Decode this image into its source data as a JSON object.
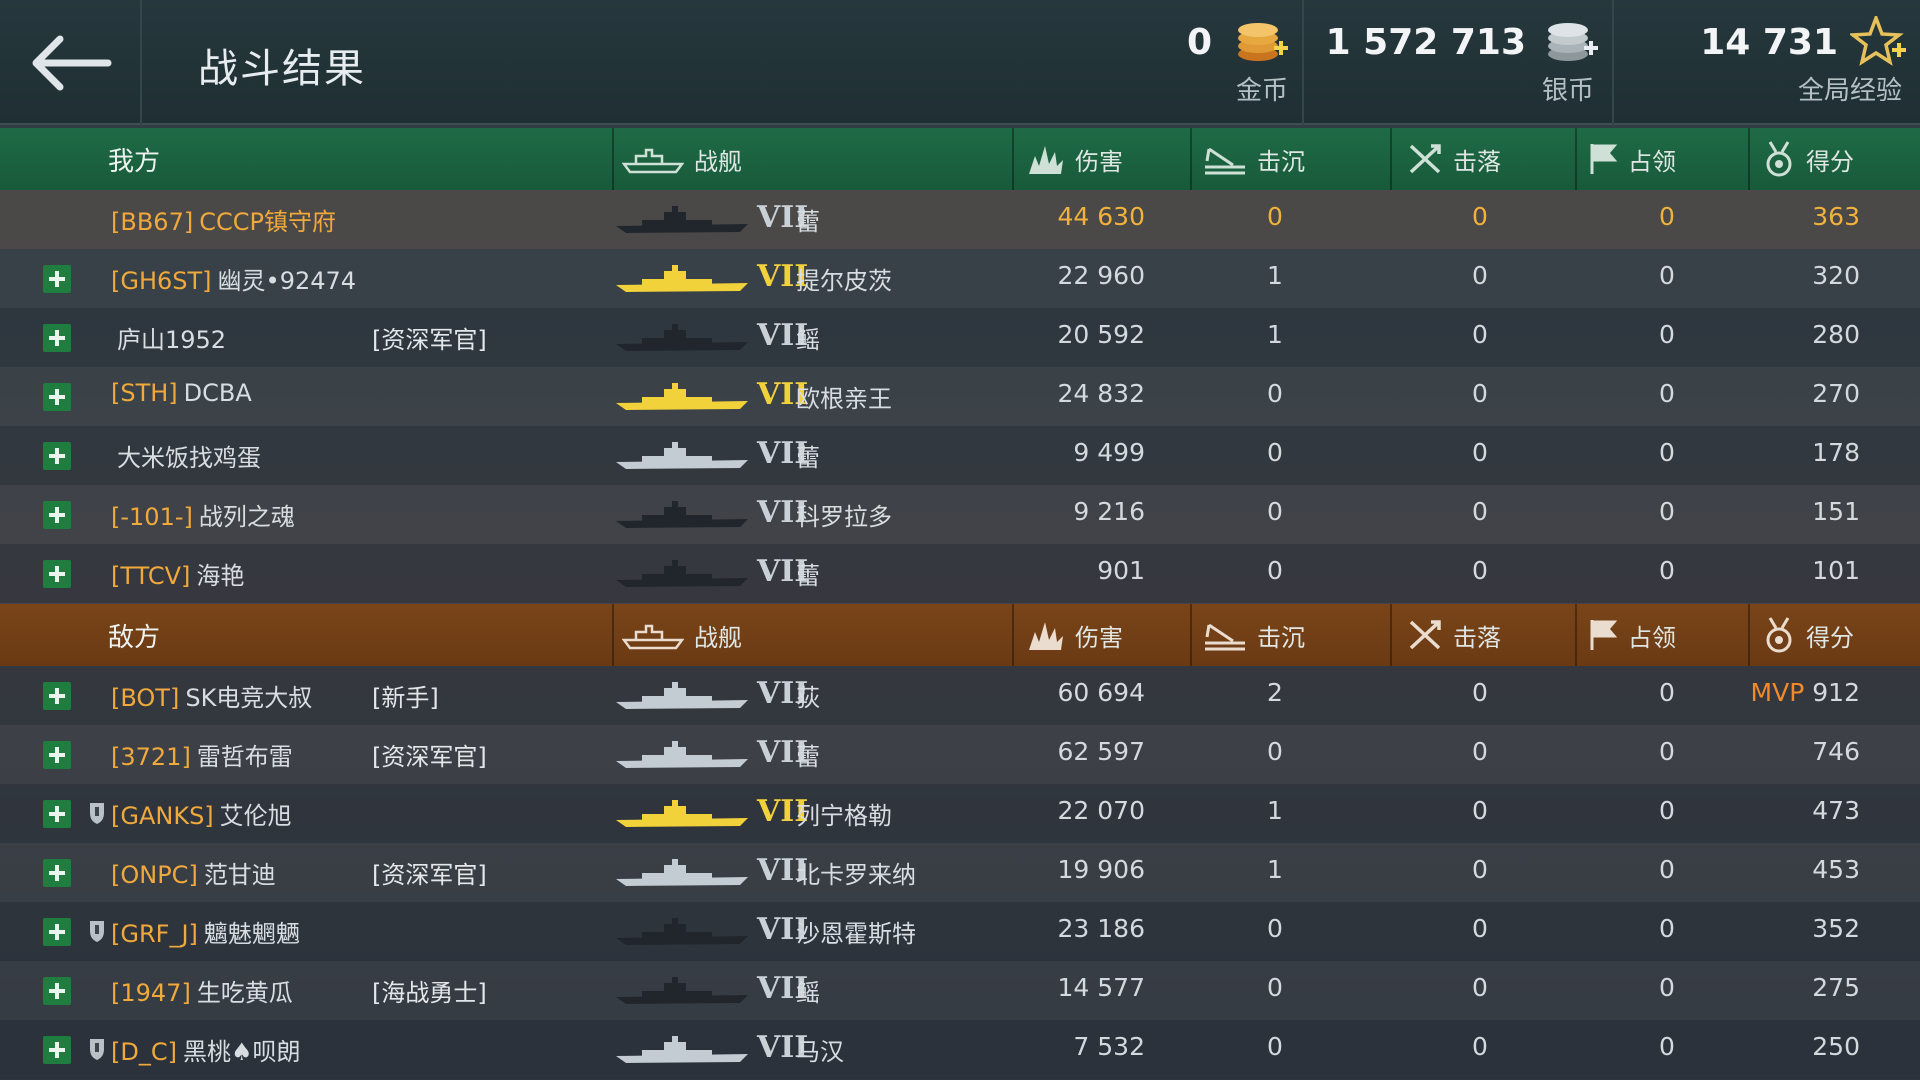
{
  "header": {
    "title": "战斗结果",
    "currencies": [
      {
        "value": "0",
        "label": "金币",
        "icon": "gold-coins-icon"
      },
      {
        "value": "1 572 713",
        "label": "银币",
        "icon": "silver-coins-icon"
      },
      {
        "value": "14 731",
        "label": "全局经验",
        "icon": "star-experience-icon"
      }
    ]
  },
  "columns": {
    "ship": "战舰",
    "damage": "伤害",
    "sink": "击沉",
    "shootdown": "击落",
    "capture": "占领",
    "score": "得分"
  },
  "ally": {
    "label": "我方",
    "rows": [
      {
        "clan": "[BB67]",
        "name": "CCCP镇守府",
        "rank": "",
        "tier": "VII",
        "ship": "蕾",
        "damage": "44 630",
        "sink": "0",
        "shootdown": "0",
        "capture": "0",
        "score": "363",
        "self": true
      },
      {
        "clan": "[GH6ST]",
        "name": "幽灵•92474",
        "rank": "",
        "tier": "VII",
        "ship": "提尔皮茨",
        "damage": "22 960",
        "sink": "1",
        "shootdown": "0",
        "capture": "0",
        "score": "320"
      },
      {
        "clan": "",
        "name": "庐山1952",
        "rank": "[资深军官]",
        "tier": "VII",
        "ship": "鳐",
        "damage": "20 592",
        "sink": "1",
        "shootdown": "0",
        "capture": "0",
        "score": "280"
      },
      {
        "clan": "[STH]",
        "name": "DCBA",
        "rank": "",
        "tier": "VII",
        "ship": "欧根亲王",
        "damage": "24 832",
        "sink": "0",
        "shootdown": "0",
        "capture": "0",
        "score": "270"
      },
      {
        "clan": "",
        "name": "大米饭找鸡蛋",
        "rank": "",
        "tier": "VII",
        "ship": "蕾",
        "damage": "9 499",
        "sink": "0",
        "shootdown": "0",
        "capture": "0",
        "score": "178"
      },
      {
        "clan": "[-101-]",
        "name": "战列之魂",
        "rank": "",
        "tier": "VII",
        "ship": "科罗拉多",
        "damage": "9 216",
        "sink": "0",
        "shootdown": "0",
        "capture": "0",
        "score": "151"
      },
      {
        "clan": "[TTCV]",
        "name": "海艳",
        "rank": "",
        "tier": "VII",
        "ship": "蕾",
        "damage": "901",
        "sink": "0",
        "shootdown": "0",
        "capture": "0",
        "score": "101"
      }
    ]
  },
  "enemy": {
    "label": "敌方",
    "rows": [
      {
        "clan": "[BOT]",
        "name": "SK电竞大叔",
        "rank": "[新手]",
        "tier": "VII",
        "ship": "荻",
        "damage": "60 694",
        "sink": "2",
        "shootdown": "0",
        "capture": "0",
        "score": "912",
        "mvp": "MVP"
      },
      {
        "clan": "[3721]",
        "name": "雷哲布雷",
        "rank": "[资深军官]",
        "tier": "VII",
        "ship": "蕾",
        "damage": "62 597",
        "sink": "0",
        "shootdown": "0",
        "capture": "0",
        "score": "746"
      },
      {
        "clan": "[GANKS]",
        "name": "艾伦旭",
        "rank": "",
        "tier": "VII",
        "ship": "列宁格勒",
        "damage": "22 070",
        "sink": "1",
        "shootdown": "0",
        "capture": "0",
        "score": "473",
        "shield": true
      },
      {
        "clan": "[ONPC]",
        "name": "范甘迪",
        "rank": "[资深军官]",
        "tier": "VII",
        "ship": "北卡罗来纳",
        "damage": "19 906",
        "sink": "1",
        "shootdown": "0",
        "capture": "0",
        "score": "453"
      },
      {
        "clan": "[GRF_J]",
        "name": "魑魅魍魉",
        "rank": "",
        "tier": "VII",
        "ship": "沙恩霍斯特",
        "damage": "23 186",
        "sink": "0",
        "shootdown": "0",
        "capture": "0",
        "score": "352",
        "shield": true
      },
      {
        "clan": "[1947]",
        "name": "生吃黄瓜",
        "rank": "[海战勇士]",
        "tier": "VII",
        "ship": "鳐",
        "damage": "14 577",
        "sink": "0",
        "shootdown": "0",
        "capture": "0",
        "score": "275"
      },
      {
        "clan": "[D_C]",
        "name": "黑桃♠呗朗",
        "rank": "",
        "tier": "VII",
        "ship": "马汉",
        "damage": "7 532",
        "sink": "0",
        "shootdown": "0",
        "capture": "0",
        "score": "250",
        "shield": true
      }
    ]
  }
}
